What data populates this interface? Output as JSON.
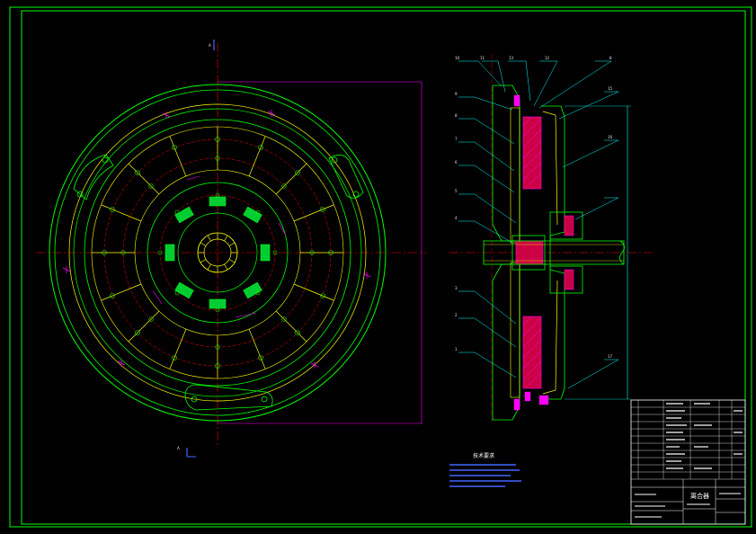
{
  "drawing": {
    "type": "engineering-cad",
    "colors": {
      "background": "#000000",
      "frame": "#00ff00",
      "outline": "#00ff00",
      "inner": "#ffff00",
      "center": "#ff0000",
      "dimension": "#00ffff",
      "hatch": "#ff00ff",
      "text": "#ffffff",
      "note": "#3355ff"
    },
    "section_callouts": [
      "10",
      "11",
      "13",
      "12",
      "8",
      "9",
      "8",
      "7",
      "6",
      "5",
      "4",
      "3",
      "2",
      "1",
      "15",
      "16",
      "17"
    ],
    "title_block": {
      "part_name": "离合器",
      "drawing_no": "",
      "school": "",
      "company_code": ""
    },
    "technical_requirements": {
      "title": "技术要求",
      "lines": []
    }
  }
}
